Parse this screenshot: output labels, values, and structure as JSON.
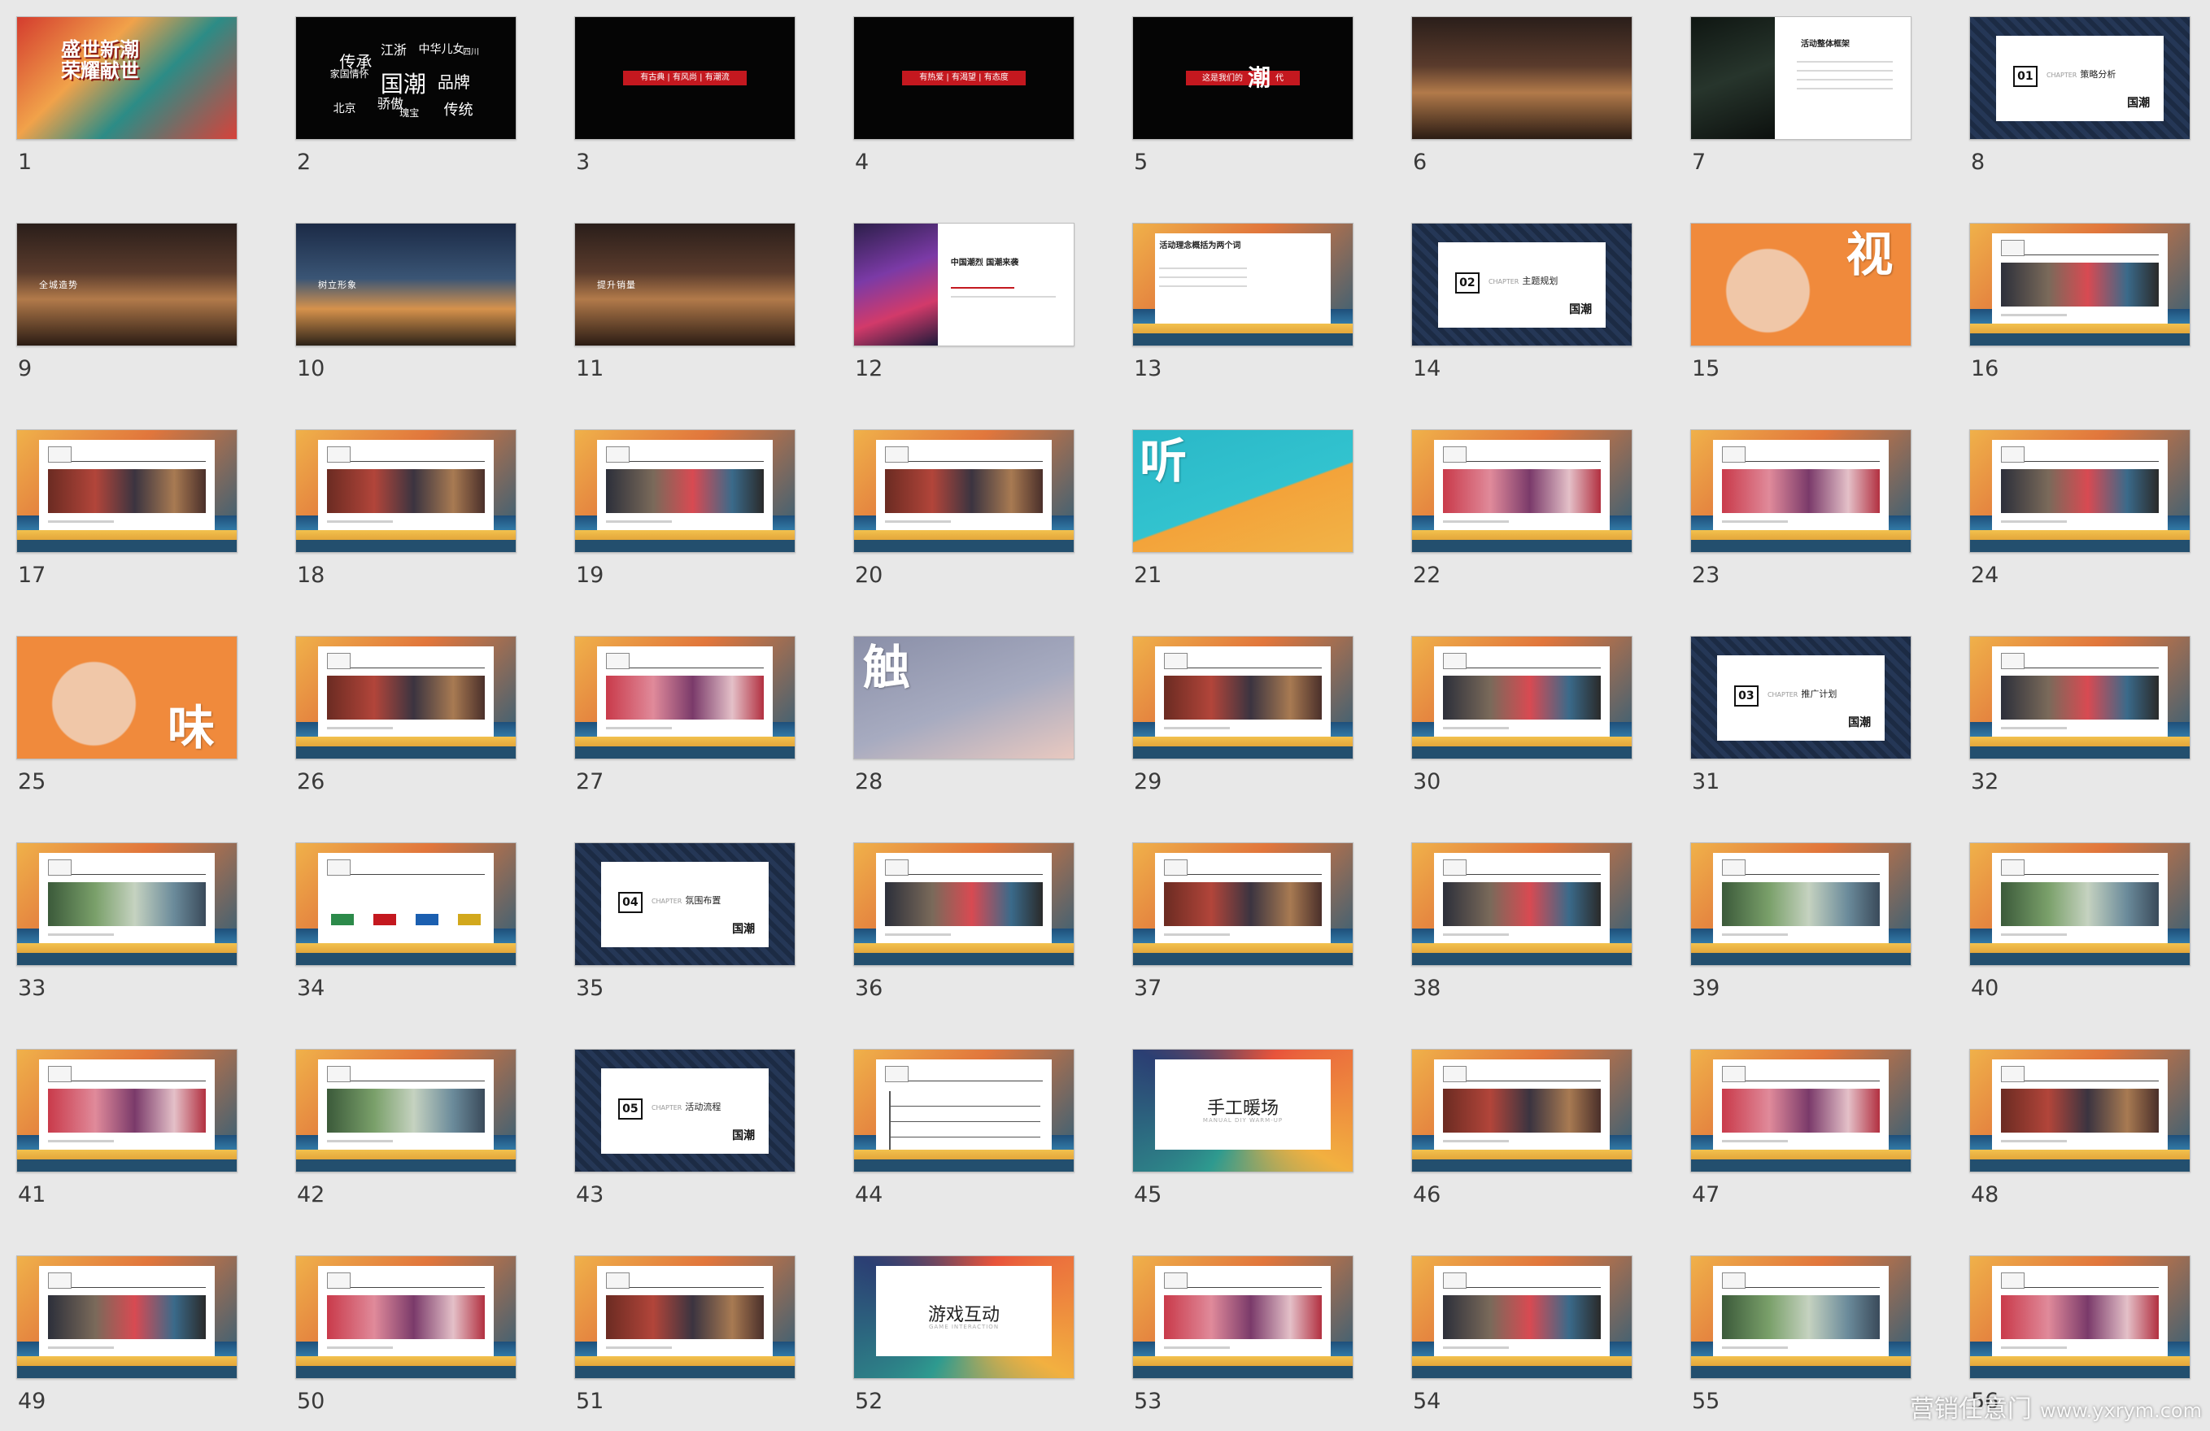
{
  "slides": [
    {
      "n": "1",
      "style": "cover",
      "title": "盛世新潮\n荣耀献世"
    },
    {
      "n": "2",
      "style": "wordcloud",
      "words": [
        "传承",
        "江浙",
        "中华儿女",
        "四川",
        "国潮",
        "家国情怀",
        "品牌",
        "骄傲",
        "北京",
        "瑰宝",
        "传统"
      ]
    },
    {
      "n": "3",
      "style": "redbar",
      "text": "有古典 | 有风尚 | 有潮流"
    },
    {
      "n": "4",
      "style": "redbar",
      "text": "有热爱 | 有渴望 | 有态度"
    },
    {
      "n": "5",
      "style": "chao",
      "text": "这是我们的",
      "big": "潮",
      "tail": "代"
    },
    {
      "n": "6",
      "style": "street"
    },
    {
      "n": "7",
      "style": "overview",
      "text": "活动整体框架"
    },
    {
      "n": "8",
      "style": "chapter",
      "num": "01",
      "title": "策略分析",
      "logo": "国潮"
    },
    {
      "n": "9",
      "style": "street",
      "text": "全城造势"
    },
    {
      "n": "10",
      "style": "city",
      "text": "树立形象"
    },
    {
      "n": "11",
      "style": "street",
      "text": "提升销量"
    },
    {
      "n": "12",
      "style": "split",
      "text": "中国潮烈 国潮来袭"
    },
    {
      "n": "13",
      "style": "concept",
      "text": "活动理念概括为两个词"
    },
    {
      "n": "14",
      "style": "chapter",
      "num": "02",
      "title": "主题规划",
      "logo": "国潮"
    },
    {
      "n": "15",
      "style": "face",
      "big": "视"
    },
    {
      "n": "16",
      "style": "ornate",
      "photo": "alt"
    },
    {
      "n": "17",
      "style": "ornate",
      "photo": "a"
    },
    {
      "n": "18",
      "style": "ornate",
      "photo": "a"
    },
    {
      "n": "19",
      "style": "ornate",
      "photo": "alt"
    },
    {
      "n": "20",
      "style": "ornate",
      "photo": "a"
    },
    {
      "n": "21",
      "style": "teal",
      "big": "听"
    },
    {
      "n": "22",
      "style": "ornate",
      "photo": "alt2"
    },
    {
      "n": "23",
      "style": "ornate",
      "photo": "alt2"
    },
    {
      "n": "24",
      "style": "ornate",
      "photo": "alt"
    },
    {
      "n": "25",
      "style": "face",
      "big": "味"
    },
    {
      "n": "26",
      "style": "ornate",
      "photo": "a"
    },
    {
      "n": "27",
      "style": "ornate",
      "photo": "alt2"
    },
    {
      "n": "28",
      "style": "lilac",
      "big": "触"
    },
    {
      "n": "29",
      "style": "ornate",
      "photo": "a"
    },
    {
      "n": "30",
      "style": "ornate",
      "photo": "alt"
    },
    {
      "n": "31",
      "style": "chapter",
      "num": "03",
      "title": "推广计划",
      "logo": "国潮"
    },
    {
      "n": "32",
      "style": "ornate",
      "photo": "alt"
    },
    {
      "n": "33",
      "style": "ornate",
      "photo": "alt3"
    },
    {
      "n": "34",
      "style": "logos"
    },
    {
      "n": "35",
      "style": "chapter",
      "num": "04",
      "title": "氛围布置",
      "logo": "国潮"
    },
    {
      "n": "36",
      "style": "ornate",
      "photo": "alt"
    },
    {
      "n": "37",
      "style": "ornate",
      "photo": "a"
    },
    {
      "n": "38",
      "style": "ornate",
      "photo": "alt"
    },
    {
      "n": "39",
      "style": "ornate",
      "photo": "alt3"
    },
    {
      "n": "40",
      "style": "ornate",
      "photo": "alt3"
    },
    {
      "n": "41",
      "style": "ornate",
      "photo": "alt2"
    },
    {
      "n": "42",
      "style": "ornate",
      "photo": "alt3"
    },
    {
      "n": "43",
      "style": "chapter",
      "num": "05",
      "title": "活动流程",
      "logo": "国潮"
    },
    {
      "n": "44",
      "style": "timeline"
    },
    {
      "n": "45",
      "style": "card",
      "title": "手工暖场",
      "sub": "MANUAL DIY WARM-UP"
    },
    {
      "n": "46",
      "style": "ornate",
      "photo": "a"
    },
    {
      "n": "47",
      "style": "ornate",
      "photo": "alt2"
    },
    {
      "n": "48",
      "style": "ornate",
      "photo": "a"
    },
    {
      "n": "49",
      "style": "ornate",
      "photo": "alt"
    },
    {
      "n": "50",
      "style": "ornate",
      "photo": "alt2"
    },
    {
      "n": "51",
      "style": "ornate",
      "photo": "a"
    },
    {
      "n": "52",
      "style": "card",
      "title": "游戏互动",
      "sub": "GAME INTERACTION"
    },
    {
      "n": "53",
      "style": "ornate",
      "photo": "alt2"
    },
    {
      "n": "54",
      "style": "ornate",
      "photo": "alt"
    },
    {
      "n": "55",
      "style": "ornate",
      "photo": "alt3"
    },
    {
      "n": "56",
      "style": "ornate",
      "photo": "alt2"
    }
  ],
  "watermark": {
    "brand": "营销任意门",
    "site": "www.yxrym.com"
  }
}
